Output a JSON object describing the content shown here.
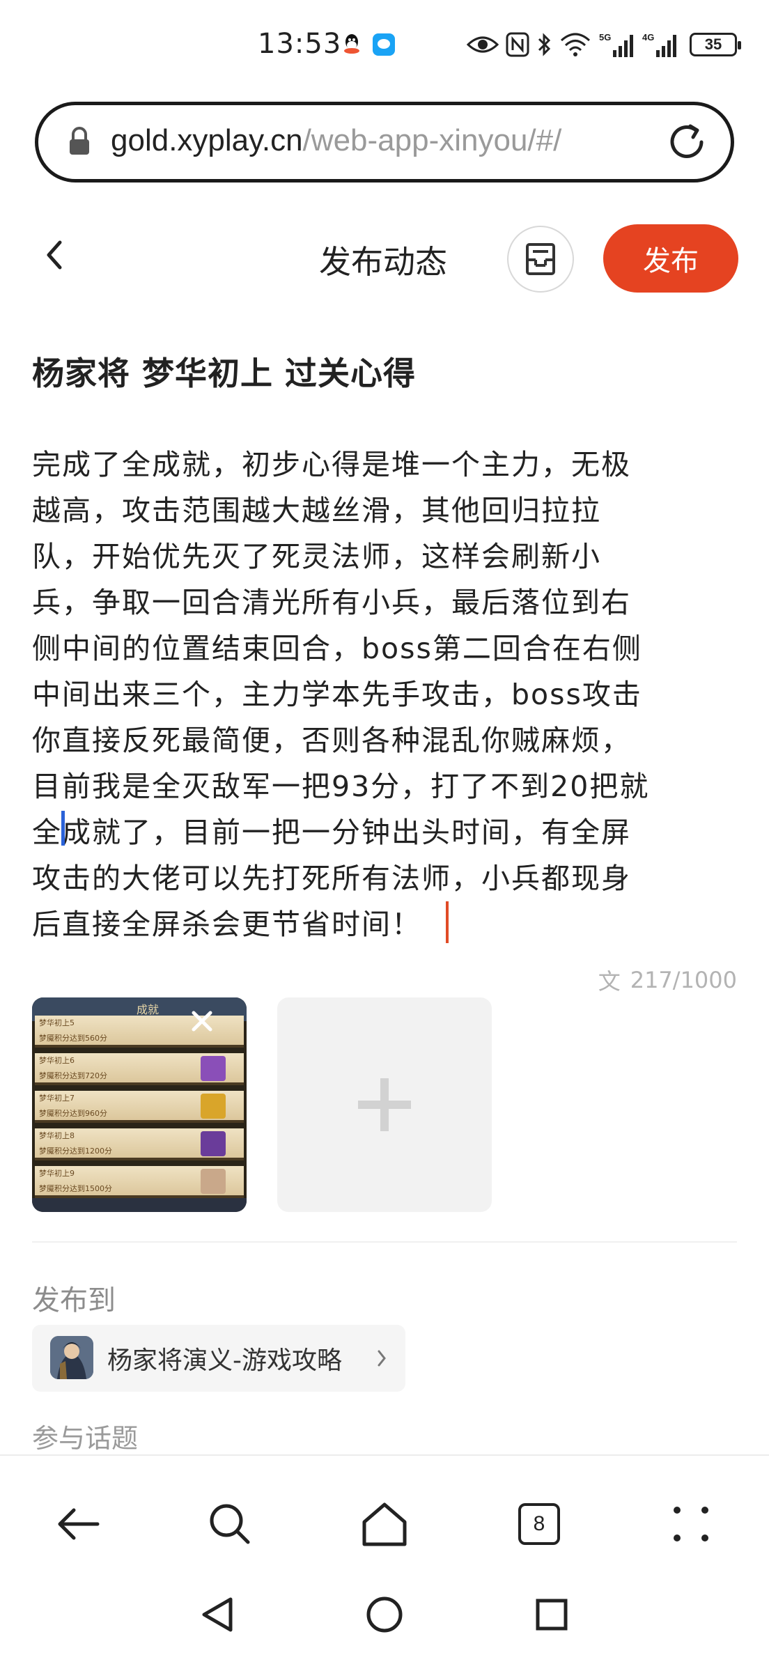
{
  "status_bar": {
    "time": "13:53",
    "network_5g": "5G",
    "network_4g": "4G",
    "battery": "35"
  },
  "browser": {
    "url_host": "gold.xyplay.cn",
    "url_path": "/web-app-xinyou/#/",
    "tabs_count": "8"
  },
  "header": {
    "title": "发布动态",
    "publish_label": "发布"
  },
  "post": {
    "title": "杨家将 梦华初上 过关心得",
    "body_lines": [
      "完成了全成就，初步心得是堆一个主力，无极",
      "越高，攻击范围越大越丝滑，其他回归拉拉",
      "队，开始优先灭了死灵法师，这样会刷新小",
      "兵，争取一回合清光所有小兵，最后落位到右",
      "侧中间的位置结束回合，boss第二回合在右侧",
      "中间出来三个，主力学本先手攻击，boss攻击",
      "你直接反死最简便，否则各种混乱你贼麻烦，",
      "目前我是全灭敌军一把93分，打了不到20把就",
      "全成就了，目前一把一分钟出头时间，有全屏",
      "攻击的大佬可以先打死所有法师，小兵都现身",
      "后直接全屏杀会更节省时间！"
    ],
    "word_count_icon": "文",
    "word_count": "217/1000"
  },
  "thumbnail": {
    "header_title": "成就",
    "rows": [
      {
        "name": "梦华初上5",
        "desc": "梦魇积分达到560分"
      },
      {
        "name": "梦华初上6",
        "desc": "梦魇积分达到720分"
      },
      {
        "name": "梦华初上7",
        "desc": "梦魇积分达到960分"
      },
      {
        "name": "梦华初上8",
        "desc": "梦魇积分达到1200分"
      },
      {
        "name": "梦华初上9",
        "desc": "梦魇积分达到1500分"
      }
    ]
  },
  "publish_to": {
    "label": "发布到",
    "game_name": "杨家将演义-游戏攻略"
  },
  "topics": {
    "label": "参与话题"
  },
  "icons": {
    "lock": "lock-icon",
    "reload": "reload-icon",
    "back": "chevron-left-icon",
    "draft": "draft-box-icon",
    "close": "close-icon",
    "add": "plus-icon",
    "search": "search-icon",
    "home": "home-icon",
    "menu": "more-dots-icon"
  },
  "colors": {
    "accent": "#e54321",
    "text": "#222222",
    "muted": "#8c8c8c"
  }
}
